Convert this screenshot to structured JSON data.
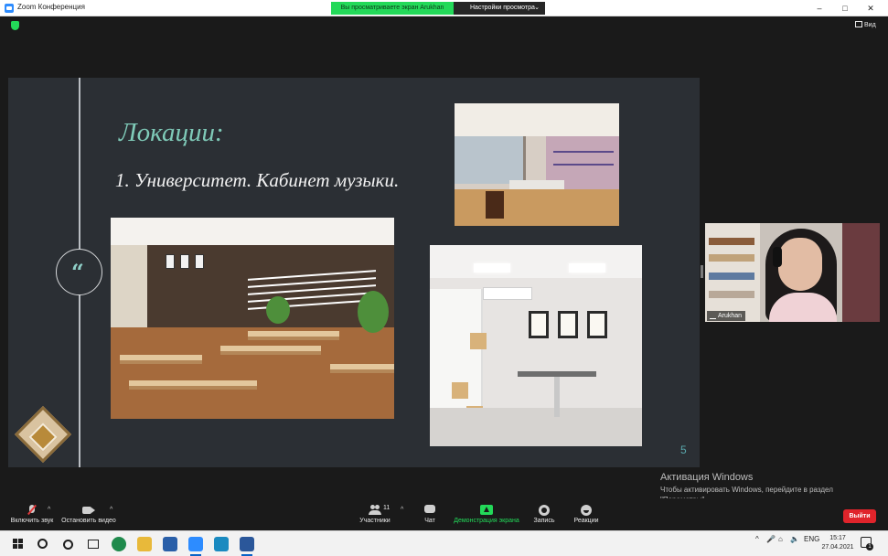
{
  "window": {
    "title": "Zoom Конференция",
    "share_banner": "Вы просматриваете экран Arukhan",
    "view_options_label": "Настройки просмотра",
    "controls": {
      "minimize": "–",
      "maximize": "□",
      "close": "✕"
    }
  },
  "meeting_bar": {
    "view_label": "Вид"
  },
  "slide": {
    "heading": "Локации:",
    "subheading": "1. Университет. Кабинет музыки.",
    "quote_mark": "“",
    "page_number": "5"
  },
  "participant": {
    "name": "Arukhan"
  },
  "activation": {
    "title": "Активация Windows",
    "text": "Чтобы активировать Windows, перейдите в раздел \"Параметры\"."
  },
  "toolbar": {
    "unmute_label": "Включить звук",
    "stop_video_label": "Остановить видео",
    "participants_label": "Участники",
    "participants_count": "11",
    "chat_label": "Чат",
    "share_label": "Демонстрация экрана",
    "record_label": "Запись",
    "reactions_label": "Реакции",
    "leave_label": "Выйти",
    "caret": "^"
  },
  "taskbar": {
    "language": "ENG",
    "time": "15:17",
    "date": "27.04.2021",
    "notifications_count": "1",
    "tray_arrow": "^"
  },
  "colors": {
    "zoom_green": "#23d959",
    "leave_red": "#e0242b",
    "slide_bg": "#2b2f34",
    "heading_teal": "#7fcab8"
  }
}
